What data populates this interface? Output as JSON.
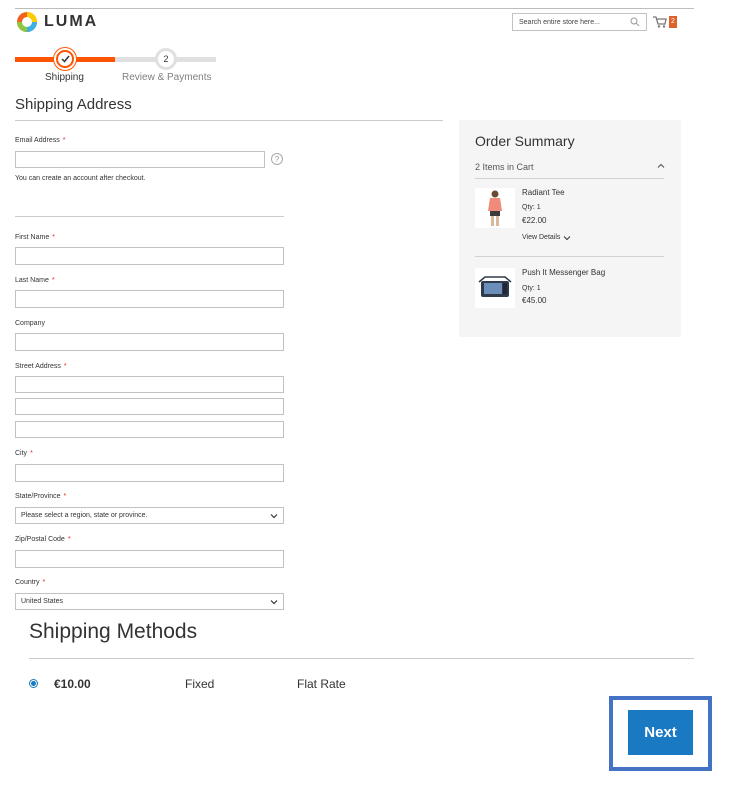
{
  "header": {
    "logo_text": "LUMA",
    "search_placeholder": "Search entire store here...",
    "cart_count": "2"
  },
  "progress": {
    "step1_label": "Shipping",
    "step2_number": "2",
    "step2_label": "Review & Payments"
  },
  "shipping_address": {
    "title": "Shipping Address",
    "email_label": "Email Address",
    "email_note": "You can create an account after checkout.",
    "first_name_label": "First Name",
    "last_name_label": "Last Name",
    "company_label": "Company",
    "street_label": "Street Address",
    "city_label": "City",
    "state_label": "State/Province",
    "state_value": "Please select a region, state or province.",
    "zip_label": "Zip/Postal Code",
    "country_label": "Country",
    "country_value": "United States",
    "required_mark": "*",
    "help_mark": "?"
  },
  "order_summary": {
    "title": "Order Summary",
    "items_count": "2 Items in Cart",
    "items": [
      {
        "name": "Radiant Tee",
        "qty": "Qty: 1",
        "price": "€22.00",
        "details": "View Details"
      },
      {
        "name": "Push It Messenger Bag",
        "qty": "Qty: 1",
        "price": "€45.00"
      }
    ]
  },
  "shipping_methods": {
    "title": "Shipping Methods",
    "price": "€10.00",
    "method": "Fixed",
    "carrier": "Flat Rate"
  },
  "actions": {
    "next_label": "Next"
  },
  "colors": {
    "accent_orange": "#ff5501",
    "primary_blue": "#1979c3",
    "highlight_blue": "#4472c4"
  }
}
